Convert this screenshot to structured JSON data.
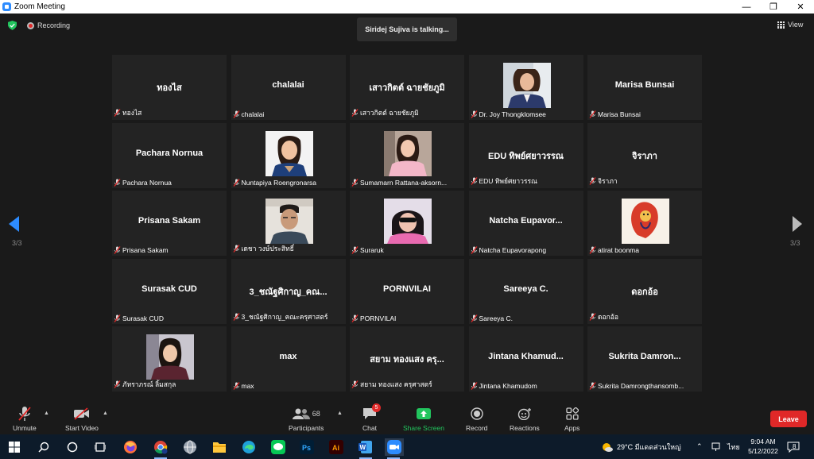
{
  "window": {
    "title": "Zoom Meeting"
  },
  "header": {
    "recording": "Recording",
    "talking": "Siridej Sujiva is talking...",
    "view": "View"
  },
  "pagination": {
    "left": "3/3",
    "right": "3/3"
  },
  "tiles": [
    {
      "big": "ทองไส",
      "label": "ทองไส",
      "video": false
    },
    {
      "big": "chalalai",
      "label": "chalalai",
      "video": false
    },
    {
      "big": "เสาวกิตต์ ฉายชัยภูมิ",
      "label": "เสาวกิตต์ ฉายชัยภูมิ",
      "video": false
    },
    {
      "big": "",
      "label": "Dr. Joy Thongklomsee",
      "video": true
    },
    {
      "big": "Marisa Bunsai",
      "label": "Marisa Bunsai",
      "video": false
    },
    {
      "big": "Pachara Nornua",
      "label": "Pachara Nornua",
      "video": false
    },
    {
      "big": "",
      "label": "Nuntapiya Roengronarsa",
      "video": true
    },
    {
      "big": "",
      "label": "Sumamarn  Rattana-aksorn...",
      "video": true
    },
    {
      "big": "EDU ทิพย์ศยาวรรณ",
      "label": "EDU ทิพย์ศยาวรรณ",
      "video": false
    },
    {
      "big": "จิราภา",
      "label": "จิราภา",
      "video": false
    },
    {
      "big": "Prisana Sakam",
      "label": "Prisana Sakam",
      "video": false
    },
    {
      "big": "",
      "label": "เดชา วงษ์ประสิทธิ์",
      "video": true
    },
    {
      "big": "",
      "label": "Suraruk",
      "video": true
    },
    {
      "big": "Natcha  Eupavor...",
      "label": "Natcha Eupavorapong",
      "video": false
    },
    {
      "big": "",
      "label": "atirat boonma",
      "video": true
    },
    {
      "big": "Surasak CUD",
      "label": "Surasak CUD",
      "video": false
    },
    {
      "big": "3_ชณัฐศิกาญ_คณ...",
      "label": "3_ชณัฐศิกาญ_คณะครุศาสตร์",
      "video": false
    },
    {
      "big": "PORNVILAI",
      "label": "PORNVILAI",
      "video": false
    },
    {
      "big": "Sareeya C.",
      "label": "Sareeya C.",
      "video": false
    },
    {
      "big": "ดอกอ้อ",
      "label": "ดอกอ้อ",
      "video": false
    },
    {
      "big": "",
      "label": "ภัทราภรณ์ ลิ้มสกุล",
      "video": true
    },
    {
      "big": "max",
      "label": "max",
      "video": false
    },
    {
      "big": "สยาม ทองแสง ครุ...",
      "label": "สยาม ทองแสง ครุศาสตร์",
      "video": false
    },
    {
      "big": "Jintana  Khamud...",
      "label": "Jintana Khamudom",
      "video": false
    },
    {
      "big": "Sukrita  Damron...",
      "label": "Sukrita Damrongthansomb...",
      "video": false
    }
  ],
  "toolbar": {
    "unmute": "Unmute",
    "start_video": "Start Video",
    "participants": "Participants",
    "participants_count": "68",
    "chat": "Chat",
    "chat_badge": "5",
    "share_screen": "Share Screen",
    "record": "Record",
    "reactions": "Reactions",
    "apps": "Apps",
    "leave": "Leave"
  },
  "taskbar": {
    "weather": "29°C  มีแดดส่วนใหญ่",
    "lang": "ไทย",
    "time": "9:04 AM",
    "date": "5/12/2022",
    "notifications": "8"
  },
  "colors": {
    "share_green": "#22c55e",
    "leave_red": "#e02828",
    "nav_blue": "#2d8cff"
  }
}
